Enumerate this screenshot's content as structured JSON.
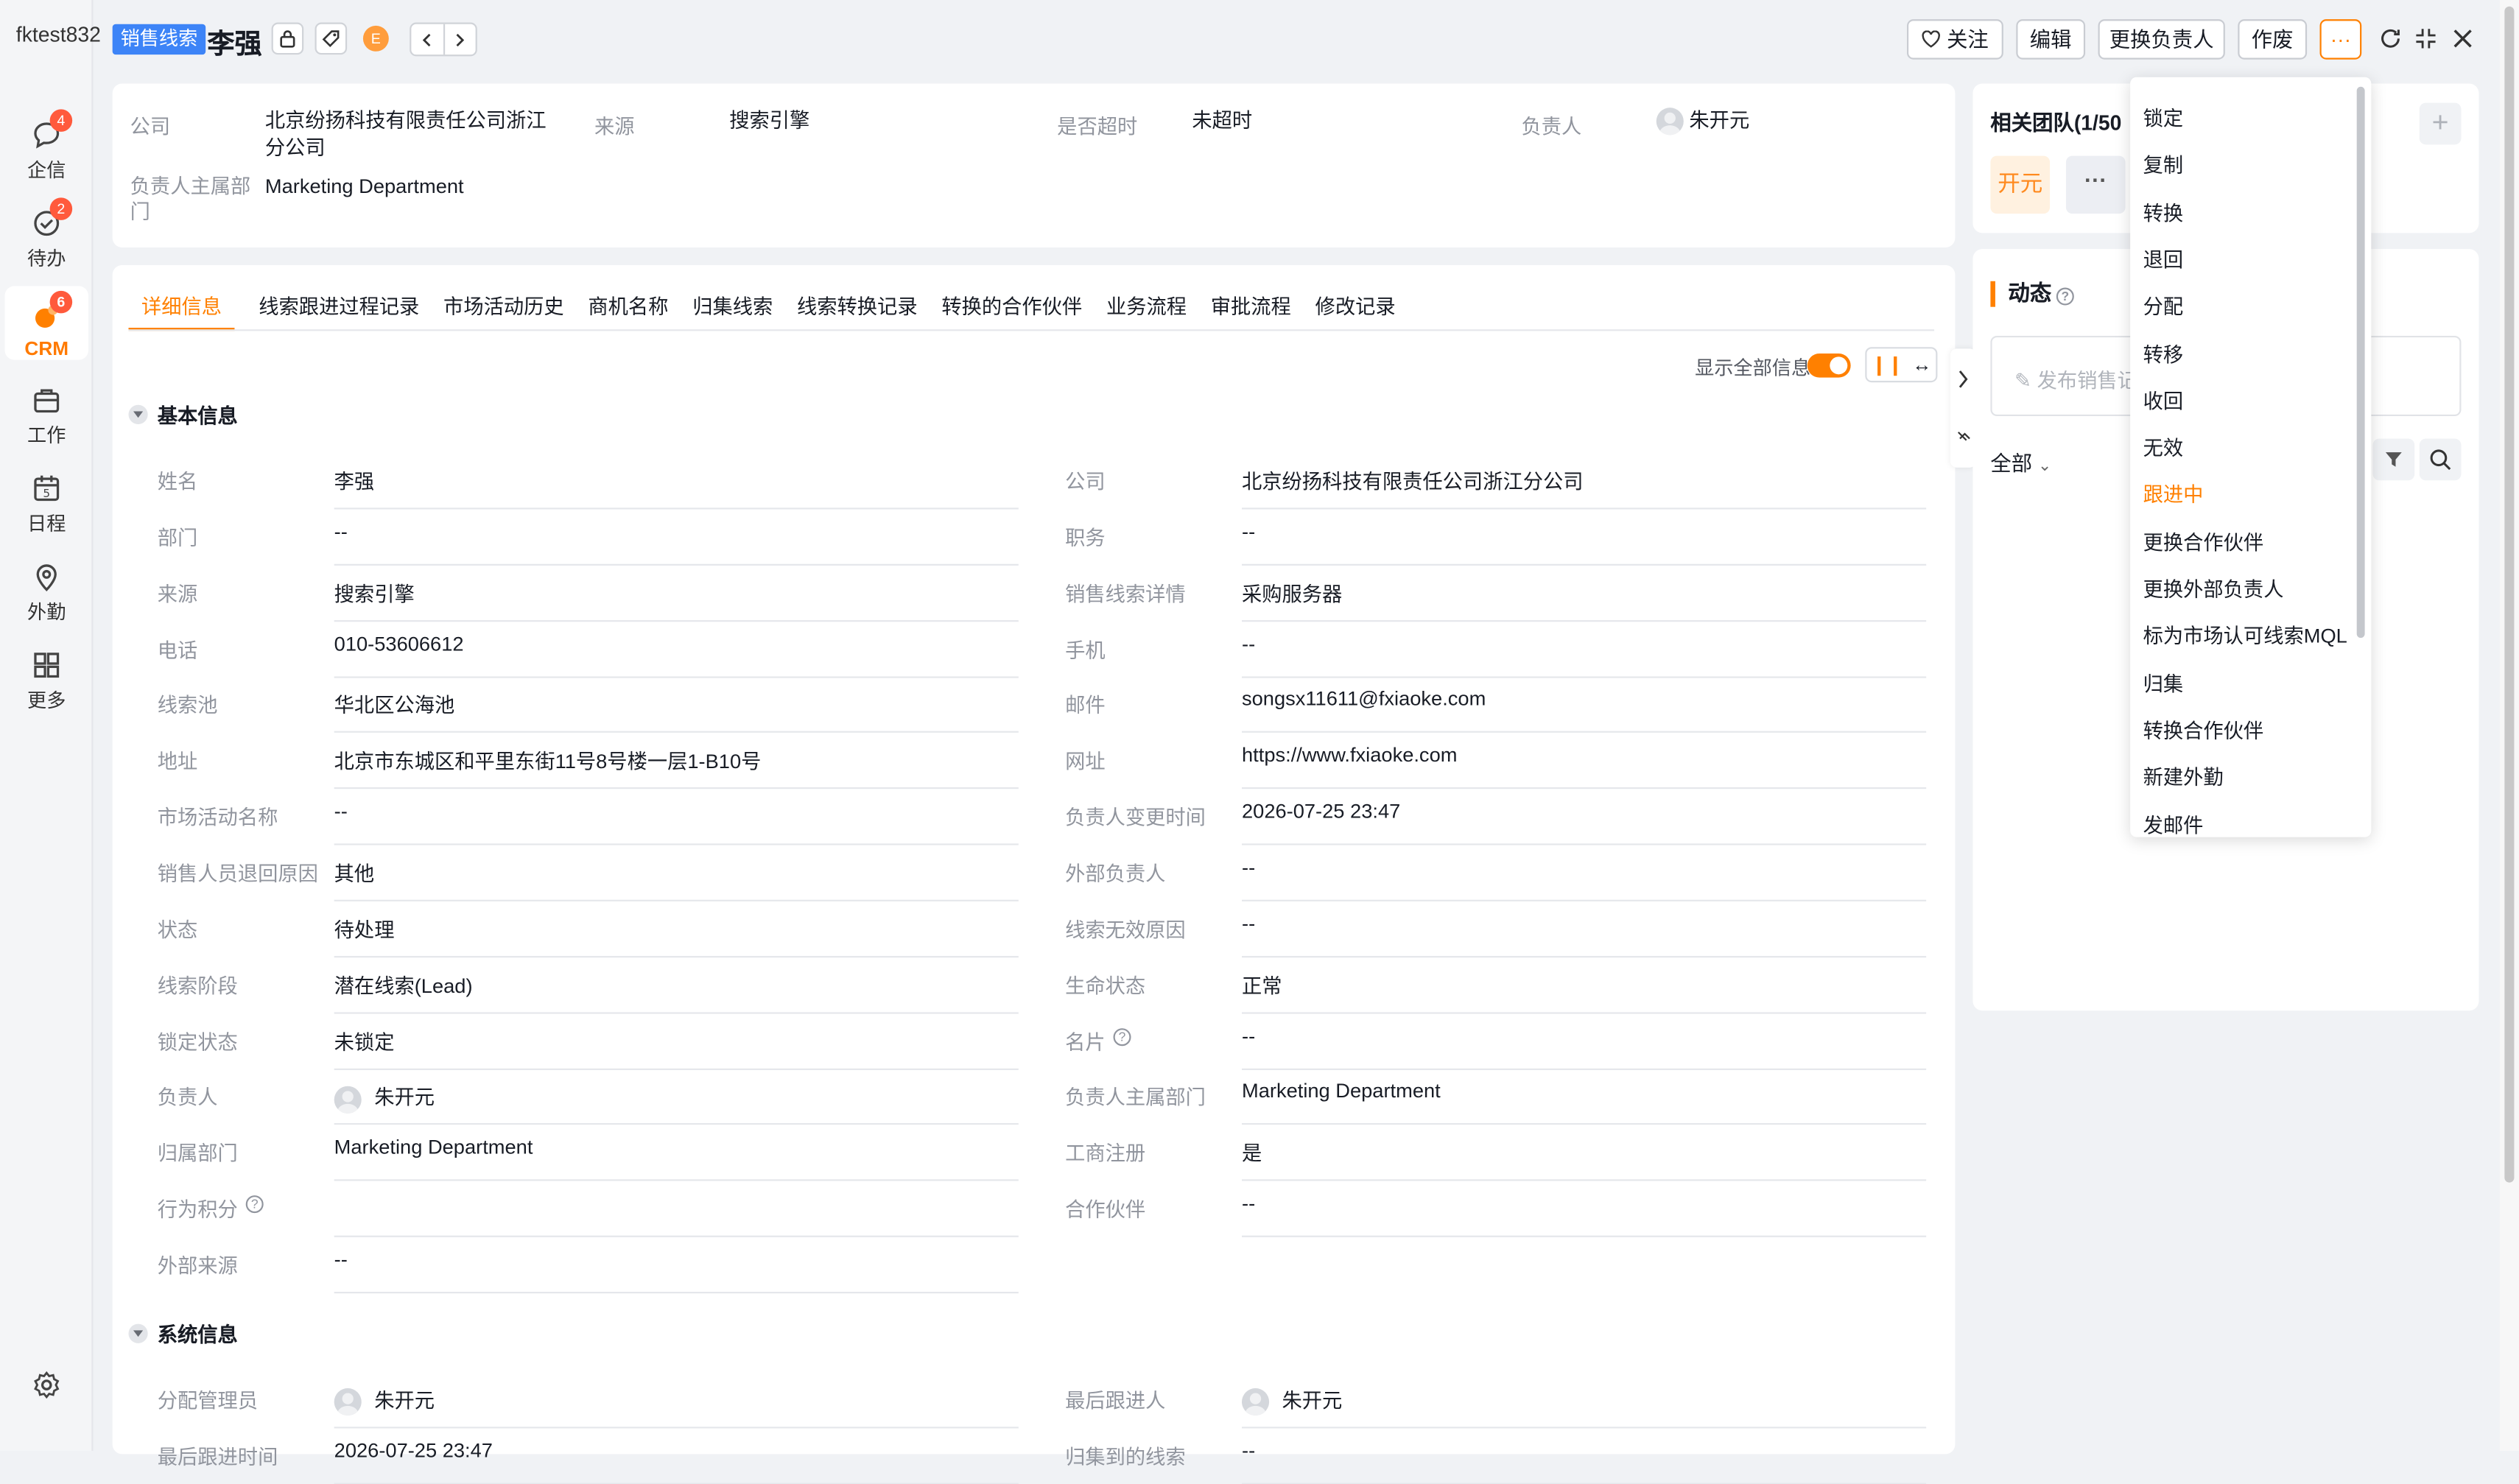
{
  "nav": {
    "account": "fktest832",
    "items": [
      {
        "label": "企信",
        "badge": "4",
        "icon": "chat-icon"
      },
      {
        "label": "待办",
        "badge": "2",
        "icon": "check-circle-icon"
      },
      {
        "label": "CRM",
        "badge": "6",
        "icon": "crm-icon"
      },
      {
        "label": "工作",
        "badge": "",
        "icon": "briefcase-icon"
      },
      {
        "label": "日程",
        "badge": "",
        "icon": "calendar-icon"
      },
      {
        "label": "外勤",
        "badge": "",
        "icon": "location-pin-icon"
      },
      {
        "label": "更多",
        "badge": "",
        "icon": "grid-icon"
      }
    ]
  },
  "header": {
    "object_type": "销售线索",
    "name": "李强",
    "coin_label": "E",
    "follow": "关注",
    "edit": "编辑",
    "change_owner": "更换负责人",
    "invalidate": "作废",
    "more": "···"
  },
  "summary": {
    "company_label": "公司",
    "company_value": "北京纷扬科技有限责任公司浙江分公司",
    "source_label": "来源",
    "source_value": "搜索引擎",
    "overdue_label": "是否超时",
    "overdue_value": "未超时",
    "owner_label": "负责人",
    "owner_value": "朱开元",
    "dept_label": "负责人主属部门",
    "dept_value": "Marketing Department"
  },
  "tabs": [
    "详细信息",
    "线索跟进过程记录",
    "市场活动历史",
    "商机名称",
    "归集线索",
    "线索转换记录",
    "转换的合作伙伴",
    "业务流程",
    "审批流程",
    "修改记录"
  ],
  "toolbar": {
    "show_all": "显示全部信息"
  },
  "sections": {
    "basic": "基本信息",
    "system": "系统信息"
  },
  "basic_left": [
    {
      "label": "姓名",
      "value": "李强"
    },
    {
      "label": "部门",
      "value": "--"
    },
    {
      "label": "来源",
      "value": "搜索引擎"
    },
    {
      "label": "电话",
      "value": "010-53606612"
    },
    {
      "label": "线索池",
      "value": "华北区公海池"
    },
    {
      "label": "地址",
      "value": "北京市东城区和平里东街11号8号楼一层1-B10号"
    },
    {
      "label": "市场活动名称",
      "value": "--"
    },
    {
      "label": "销售人员退回原因",
      "value": "其他"
    },
    {
      "label": "状态",
      "value": "待处理"
    },
    {
      "label": "线索阶段",
      "value": "潜在线索(Lead)"
    },
    {
      "label": "锁定状态",
      "value": "未锁定"
    },
    {
      "label": "负责人",
      "value": "朱开元"
    },
    {
      "label": "归属部门",
      "value": "Marketing Department"
    },
    {
      "label": "行为积分",
      "value": ""
    },
    {
      "label": "外部来源",
      "value": "--"
    }
  ],
  "basic_right": [
    {
      "label": "公司",
      "value": "北京纷扬科技有限责任公司浙江分公司"
    },
    {
      "label": "职务",
      "value": "--"
    },
    {
      "label": "销售线索详情",
      "value": "采购服务器"
    },
    {
      "label": "手机",
      "value": "--"
    },
    {
      "label": "邮件",
      "value": "songsx11611@fxiaoke.com"
    },
    {
      "label": "网址",
      "value": "https://www.fxiaoke.com"
    },
    {
      "label": "负责人变更时间",
      "value": "2026-07-25 23:47"
    },
    {
      "label": "外部负责人",
      "value": "--"
    },
    {
      "label": "线索无效原因",
      "value": "--"
    },
    {
      "label": "生命状态",
      "value": "正常"
    },
    {
      "label": "名片",
      "value": "--"
    },
    {
      "label": "负责人主属部门",
      "value": "Marketing Department"
    },
    {
      "label": "工商注册",
      "value": "是"
    },
    {
      "label": "合作伙伴",
      "value": "--"
    }
  ],
  "system_left": [
    {
      "label": "分配管理员",
      "value": "朱开元"
    },
    {
      "label": "最后跟进时间",
      "value": "2026-07-25 23:47"
    }
  ],
  "system_right": [
    {
      "label": "最后跟进人",
      "value": "朱开元"
    },
    {
      "label": "归集到的线索",
      "value": "--"
    }
  ],
  "team": {
    "title": "相关团队(1/50",
    "member": "开元",
    "more": "···"
  },
  "activity": {
    "title": "动态",
    "post_placeholder": "发布销售记",
    "filter": "全部"
  },
  "menu": [
    "锁定",
    "复制",
    "转换",
    "退回",
    "分配",
    "转移",
    "收回",
    "无效",
    "跟进中",
    "更换合作伙伴",
    "更换外部负责人",
    "标为市场认可线索MQL",
    "归集",
    "转换合作伙伴",
    "新建外勤",
    "发邮件"
  ],
  "colors": {
    "accent": "#ff8000",
    "tag": "#3d84f7",
    "badge": "#ff5a3c"
  }
}
